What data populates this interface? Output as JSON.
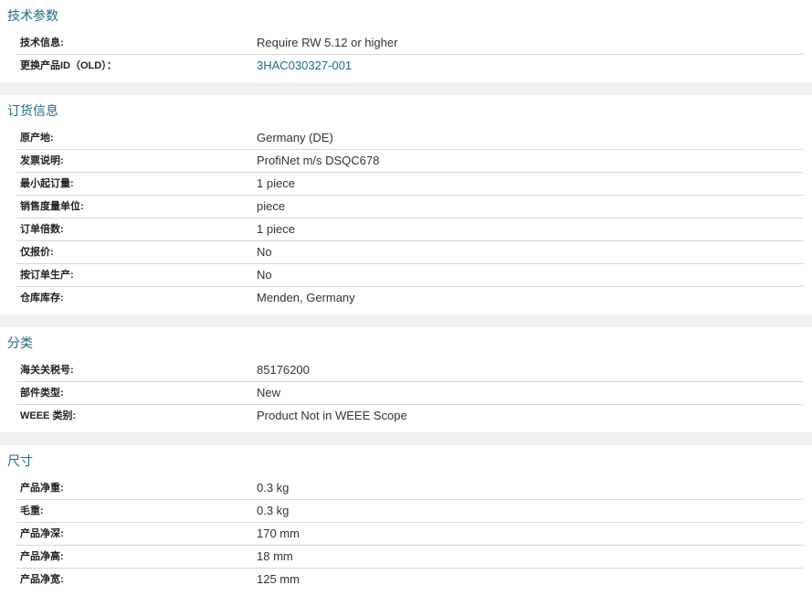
{
  "sections": [
    {
      "title": "技术参数",
      "rows": [
        {
          "label": "技术信息:",
          "value": "Require RW 5.12 or higher"
        },
        {
          "label": "更换产品ID（OLD）：",
          "value": "3HAC030327-001"
        }
      ]
    },
    {
      "title": "订货信息",
      "rows": [
        {
          "label": "原产地:",
          "value": "Germany (DE)"
        },
        {
          "label": "发票说明:",
          "value": "ProfiNet m/s DSQC678"
        },
        {
          "label": "最小起订量:",
          "value": "1 piece"
        },
        {
          "label": "销售度量单位:",
          "value": "piece"
        },
        {
          "label": "订单倍数:",
          "value": "1 piece"
        },
        {
          "label": "仅报价:",
          "value": "No"
        },
        {
          "label": "按订单生产:",
          "value": "No"
        },
        {
          "label": "仓库库存:",
          "value": "Menden, Germany"
        }
      ]
    },
    {
      "title": "分类",
      "rows": [
        {
          "label": "海关关税号:",
          "value": "85176200"
        },
        {
          "label": "部件类型:",
          "value": "New"
        },
        {
          "label": "WEEE 类别:",
          "value": "Product Not in WEEE Scope"
        }
      ]
    },
    {
      "title": "尺寸",
      "rows": [
        {
          "label": "产品净重:",
          "value": "0.3 kg"
        },
        {
          "label": "毛重:",
          "value": "0.3 kg"
        },
        {
          "label": "产品净深:",
          "value": "170 mm"
        },
        {
          "label": "产品净高:",
          "value": "18 mm"
        },
        {
          "label": "产品净宽:",
          "value": "125 mm"
        }
      ]
    }
  ],
  "colors": {
    "section_title": "#1e6e82",
    "link": "#1a6f8a",
    "divider": "#d6d6d6",
    "gap": "#f0f0f0"
  }
}
